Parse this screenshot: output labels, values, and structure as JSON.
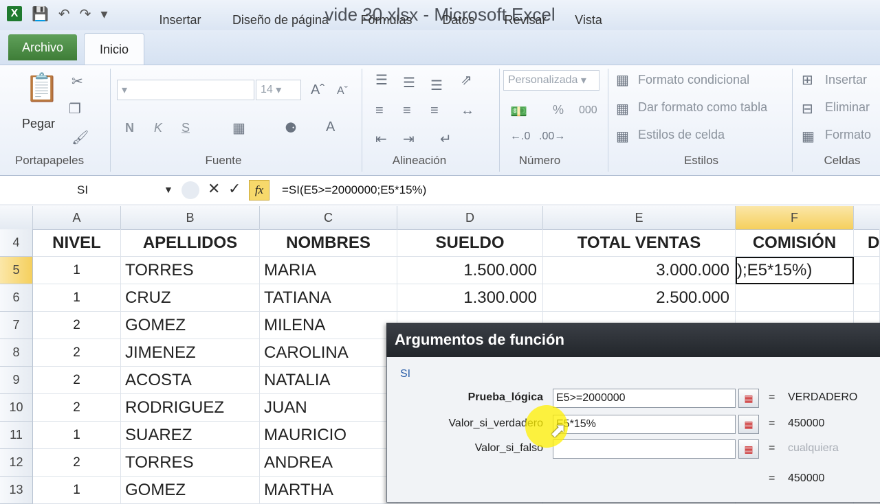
{
  "window": {
    "title": "vide 30.xlsx - Microsoft Excel"
  },
  "tabs": {
    "archivo": "Archivo",
    "inicio": "Inicio",
    "insertar": "Insertar",
    "diseno": "Diseño de página",
    "formulas": "Fórmulas",
    "datos": "Datos",
    "revisar": "Revisar",
    "vista": "Vista"
  },
  "ribbon": {
    "portapapeles": {
      "label": "Portapapeles",
      "pegar": "Pegar"
    },
    "fuente": {
      "label": "Fuente",
      "size": "14",
      "bold": "N",
      "italic": "K",
      "underline": "S"
    },
    "alineacion": {
      "label": "Alineación"
    },
    "numero": {
      "label": "Número",
      "format": "Personalizada",
      "percent": "%",
      "thousands": "000"
    },
    "estilos": {
      "label": "Estilos",
      "formato_condicional": "Formato condicional",
      "dar_formato": "Dar formato como tabla",
      "estilos_celda": "Estilos de celda"
    },
    "celdas": {
      "label": "Celdas",
      "insertar": "Insertar",
      "eliminar": "Eliminar",
      "formato": "Formato"
    }
  },
  "formula_bar": {
    "name_box": "SI",
    "fx": "fx",
    "formula": "=SI(E5>=2000000;E5*15%)"
  },
  "columns": [
    "A",
    "B",
    "C",
    "D",
    "E",
    "F"
  ],
  "header_row": {
    "row": "4",
    "cells": [
      "NIVEL",
      "APELLIDOS",
      "NOMBRES",
      "SUELDO",
      "TOTAL VENTAS",
      "COMISIÓN",
      "D"
    ]
  },
  "rows": [
    {
      "row": "5",
      "nivel": "1",
      "apellido": "TORRES",
      "nombre": "MARIA",
      "sueldo": "1.500.000",
      "ventas": "3.000.000",
      "comision": ");E5*15%)"
    },
    {
      "row": "6",
      "nivel": "1",
      "apellido": "CRUZ",
      "nombre": "TATIANA",
      "sueldo": "1.300.000",
      "ventas": "2.500.000",
      "comision": ""
    },
    {
      "row": "7",
      "nivel": "2",
      "apellido": "GOMEZ",
      "nombre": "MILENA",
      "sueldo": "",
      "ventas": "",
      "comision": ""
    },
    {
      "row": "8",
      "nivel": "2",
      "apellido": "JIMENEZ",
      "nombre": "CAROLINA",
      "sueldo": "",
      "ventas": "",
      "comision": ""
    },
    {
      "row": "9",
      "nivel": "2",
      "apellido": "ACOSTA",
      "nombre": "NATALIA",
      "sueldo": "",
      "ventas": "",
      "comision": ""
    },
    {
      "row": "10",
      "nivel": "2",
      "apellido": "RODRIGUEZ",
      "nombre": "JUAN",
      "sueldo": "",
      "ventas": "",
      "comision": ""
    },
    {
      "row": "11",
      "nivel": "1",
      "apellido": "SUAREZ",
      "nombre": "MAURICIO",
      "sueldo": "",
      "ventas": "",
      "comision": ""
    },
    {
      "row": "12",
      "nivel": "2",
      "apellido": "TORRES",
      "nombre": "ANDREA",
      "sueldo": "",
      "ventas": "",
      "comision": ""
    },
    {
      "row": "13",
      "nivel": "1",
      "apellido": "GOMEZ",
      "nombre": "MARTHA",
      "sueldo": "",
      "ventas": "",
      "comision": ""
    }
  ],
  "dialog": {
    "title": "Argumentos de función",
    "function_name": "SI",
    "args": [
      {
        "label": "Prueba_lógica",
        "value": "E5>=2000000",
        "result": "VERDADERO"
      },
      {
        "label": "Valor_si_verdadero",
        "value": "E5*15%",
        "result": "450000"
      },
      {
        "label": "Valor_si_falso",
        "value": "",
        "result": "cualquiera"
      }
    ],
    "eq": "=",
    "total_result": "450000"
  }
}
